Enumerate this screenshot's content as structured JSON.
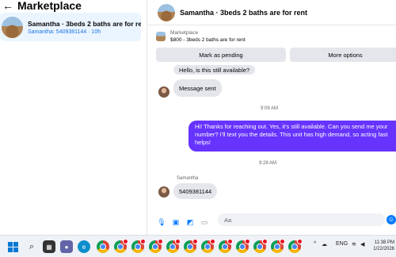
{
  "sidebar": {
    "back_icon": "←",
    "title": "Marketplace",
    "conversation": {
      "name": "Samantha · 3beds 2 baths are for re...",
      "subtitle": "Samantha: 5409381144 · 10h"
    }
  },
  "chat": {
    "header_title": "Samantha · 3beds 2 baths are for rent",
    "listing": {
      "label": "Marketplace",
      "price_title": "$800 - 3beds 2 baths are for rent"
    },
    "buttons": {
      "pending": "Mark as pending",
      "more": "More options"
    },
    "messages": {
      "in_1": "Hello, is this still available?",
      "in_2": "Message sent",
      "time_1": "9:09 AM",
      "out_1": "Hi! Thanks for reaching out. Yes, it's still available. Can you send me your number? I'll text you the details. This unit has high demand, so acting fast helps!",
      "time_2": "9:28 AM",
      "sender": "Samantha",
      "in_3": "5409381144"
    },
    "composer": {
      "placeholder": "Aa"
    }
  },
  "taskbar": {
    "tray_language": "ENG",
    "time": "11:38 PM",
    "date": "1/22/2026"
  },
  "colors": {
    "accent": "#0a7cff",
    "outgoing_bubble": "#6633ff"
  }
}
